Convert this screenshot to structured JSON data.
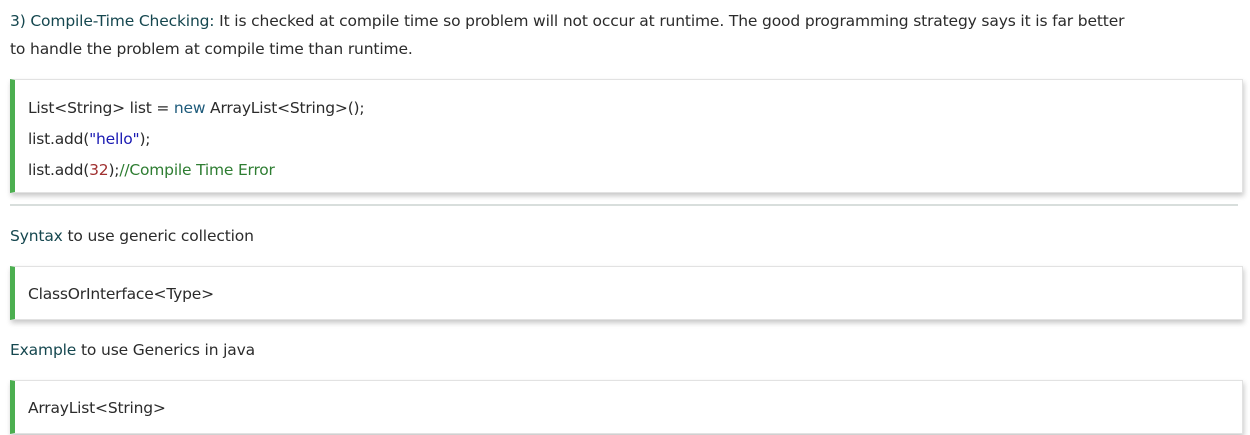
{
  "section": {
    "heading": "3) Compile-Time Checking:",
    "text_line1": " It is checked at compile time so problem will not occur at runtime. The good programming strategy says it is far better",
    "text_line2": "to handle the problem at compile time than runtime."
  },
  "code1": {
    "line1": {
      "a": "List<String> list = ",
      "kw": "new",
      "b": " ArrayList<String>();"
    },
    "line2": {
      "a": "list.add(",
      "str": "\"hello\"",
      "b": ");"
    },
    "line3": {
      "a": "list.add(",
      "num": "32",
      "b": ");",
      "comment": "//Compile Time Error"
    }
  },
  "syntax": {
    "label": "Syntax",
    "text": " to use generic collection"
  },
  "code2": {
    "line1": "ClassOrInterface<Type>"
  },
  "example": {
    "label": "Example",
    "text": " to use Generics in java"
  },
  "code3": {
    "line1": "ArrayList<String>"
  },
  "colors": {
    "accent_bar": "#4caf50",
    "heading": "#15474f",
    "keyword": "#1e5b7b",
    "string": "#1a1ab3",
    "number": "#a03030",
    "comment": "#2e7d32"
  }
}
